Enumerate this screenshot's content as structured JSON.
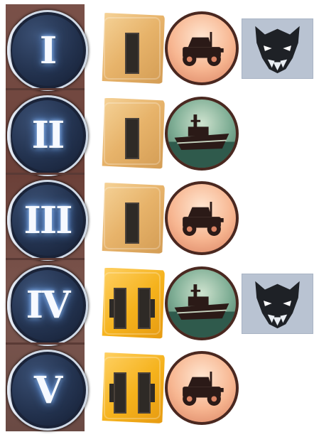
{
  "tiers": [
    {
      "numeral": "I",
      "badge": "pale",
      "bars": 1,
      "vehicle": "jeep",
      "vehicle_icon": "jeep-icon",
      "boss": true
    },
    {
      "numeral": "II",
      "badge": "pale",
      "bars": 1,
      "vehicle": "boat",
      "vehicle_icon": "boat-icon",
      "boss": false
    },
    {
      "numeral": "III",
      "badge": "pale",
      "bars": 1,
      "vehicle": "jeep",
      "vehicle_icon": "jeep-icon",
      "boss": false
    },
    {
      "numeral": "IV",
      "badge": "gold",
      "bars": 2,
      "vehicle": "boat",
      "vehicle_icon": "boat-icon",
      "boss": true
    },
    {
      "numeral": "V",
      "badge": "gold",
      "bars": 2,
      "vehicle": "jeep",
      "vehicle_icon": "jeep-icon",
      "boss": false
    }
  ],
  "icons": {
    "boss": "dragon-skull-icon"
  },
  "colors": {
    "badge_pale": "#e7b36a",
    "badge_gold": "#f5b21c",
    "medal": "#22314d",
    "token_border": "#4a2820"
  }
}
